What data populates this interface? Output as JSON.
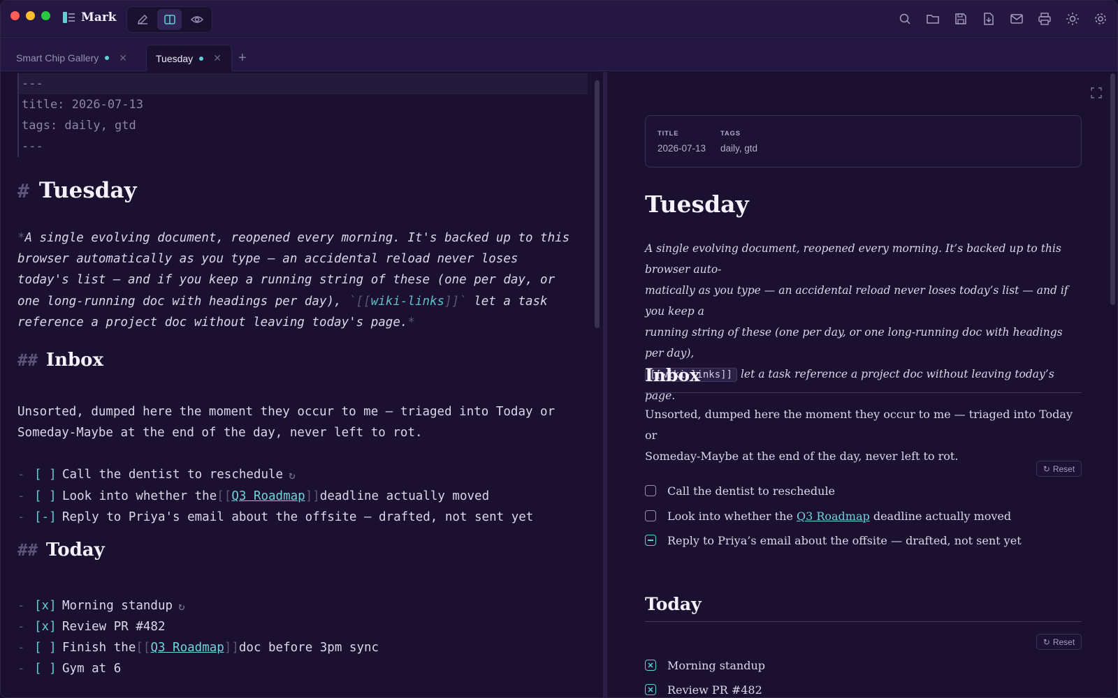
{
  "app": {
    "name": "Mark"
  },
  "colors": {
    "accent": "#5fd0d0",
    "background": "#1b1030",
    "chrome": "#241741",
    "link": "#6fd3dc"
  },
  "titlebar": {
    "modes": [
      {
        "name": "edit-mode-icon",
        "active": false
      },
      {
        "name": "split-mode-icon",
        "active": true
      },
      {
        "name": "preview-mode-icon",
        "active": false
      }
    ],
    "tools": [
      "search-icon",
      "open-folder-icon",
      "save-icon",
      "export-icon",
      "mail-icon",
      "print-icon",
      "theme-icon",
      "settings-icon"
    ]
  },
  "tabs": [
    {
      "label": "Smart Chip Gallery",
      "modified": true,
      "active": false
    },
    {
      "label": "Tuesday",
      "modified": true,
      "active": true
    }
  ],
  "editor": {
    "frontmatter": [
      "---",
      "title: 2026-07-13",
      "tags: daily, gtd",
      "---"
    ],
    "h1_marker": "#",
    "h1": "Tuesday",
    "intro": {
      "star": "*",
      "line1": "A single evolving document, reopened every morning. It's backed up to this",
      "line2": "browser automatically as you type — an accidental reload never loses",
      "line3": "today's list — and if you keep a running string of these (one per day, or",
      "line4_pre": "one long-running doc with headings per day), ",
      "tick_open": "`[[",
      "wiki": "wiki-links",
      "tick_close": "]]`",
      "line4_post": " let a task",
      "line5": "reference a project doc without leaving today's page."
    },
    "inbox": {
      "marker": "##",
      "heading": "Inbox",
      "desc1": "Unsorted, dumped here the moment they occur to me — triaged into Today or",
      "desc2": "Someday-Maybe at the end of the day, never left to rot.",
      "tasks": [
        {
          "dash": "-",
          "box": "[ ]",
          "pre": "Call the dentist to reschedule",
          "repeat": "↻"
        },
        {
          "dash": "-",
          "box": "[ ]",
          "pre": "Look into whether the ",
          "bo": "[[",
          "link": "Q3 Roadmap",
          "bc": "]]",
          "post": " deadline actually moved"
        },
        {
          "dash": "-",
          "box": "[-]",
          "pre": "Reply to Priya's email about the offsite — drafted, not sent yet"
        }
      ]
    },
    "today": {
      "marker": "##",
      "heading": "Today",
      "tasks": [
        {
          "dash": "-",
          "box": "[x]",
          "pre": "Morning standup",
          "repeat": "↻"
        },
        {
          "dash": "-",
          "box": "[x]",
          "pre": "Review PR #482"
        },
        {
          "dash": "-",
          "box": "[ ]",
          "pre": "Finish the ",
          "bo": "[[",
          "link": "Q3 Roadmap",
          "bc": "]]",
          "post": " doc before 3pm sync"
        },
        {
          "dash": "-",
          "box": "[ ]",
          "pre": "Gym at 6"
        }
      ]
    }
  },
  "preview": {
    "meta": {
      "title_key": "TITLE",
      "title_val": "2026-07-13",
      "tags_key": "TAGS",
      "tags_val": "daily, gtd"
    },
    "h1": "Tuesday",
    "intro": {
      "line1": "A single evolving document, reopened every morning. It’s backed up to this browser auto-",
      "line2": "matically as you type — an accidental reload never loses today’s list — and if you keep a",
      "line3": "running string of these (one per day, or one long-running doc with headings per day),",
      "code": "[[wiki-links]]",
      "line4": " let a task reference a project doc without leaving today’s page."
    },
    "inbox": {
      "heading": "Inbox",
      "desc1": "Unsorted, dumped here the moment they occur to me — triaged into Today or",
      "desc2": "Someday-Maybe at the end of the day, never left to rot.",
      "reset": "Reset",
      "tasks": [
        {
          "state": "unchecked",
          "pre": "Call the dentist to reschedule"
        },
        {
          "state": "unchecked",
          "pre": "Look into whether the ",
          "link": "Q3 Roadmap",
          "post": " deadline actually moved"
        },
        {
          "state": "partial",
          "pre": "Reply to Priya’s email about the offsite — drafted, not sent yet"
        }
      ]
    },
    "today": {
      "heading": "Today",
      "reset": "Reset",
      "tasks": [
        {
          "state": "done",
          "pre": "Morning standup"
        },
        {
          "state": "done",
          "pre": "Review PR #482"
        }
      ]
    }
  }
}
